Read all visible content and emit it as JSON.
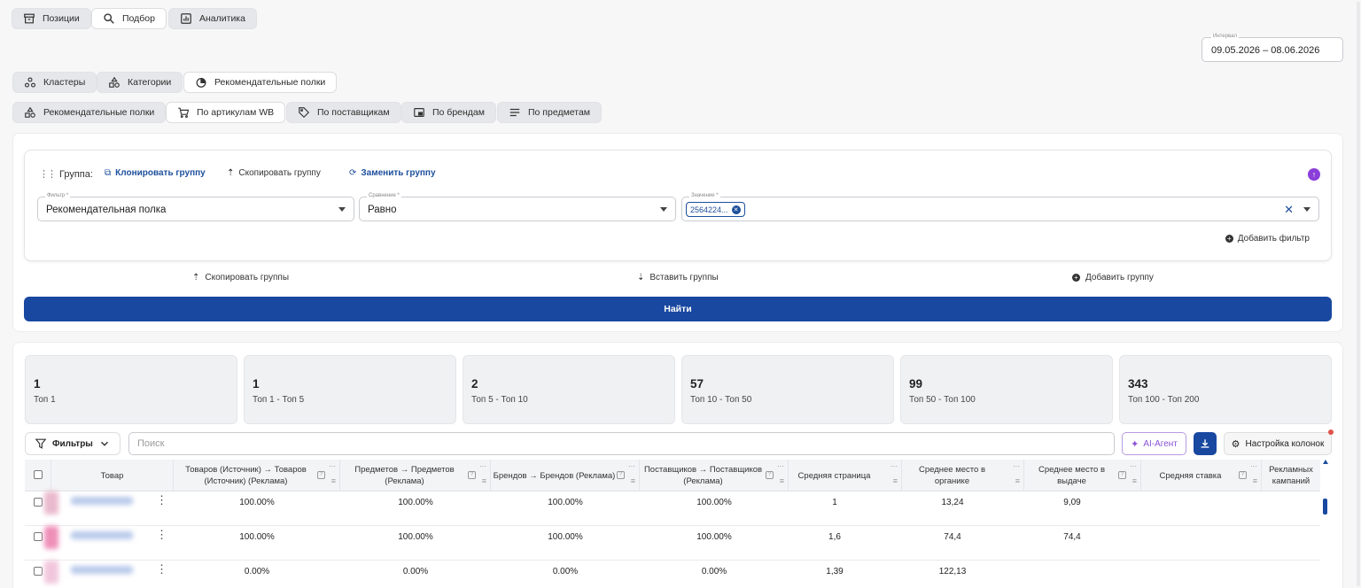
{
  "main_tabs": [
    {
      "label": "Позиции",
      "icon": "archive-box-icon"
    },
    {
      "label": "Подбор",
      "icon": "search-icon"
    },
    {
      "label": "Аналитика",
      "icon": "bar-chart-icon"
    }
  ],
  "date_range": {
    "label": "Интервал",
    "value": "09.05.2026 – 08.06.2026"
  },
  "sub_tabs": [
    {
      "label": "Кластеры",
      "icon": "cluster-icon"
    },
    {
      "label": "Категории",
      "icon": "shapes-icon"
    },
    {
      "label": "Рекомендательные полки",
      "icon": "pie-chart-icon"
    }
  ],
  "filter_tabs": [
    {
      "label": "Рекомендательные полки",
      "icon": "shapes-icon"
    },
    {
      "label": "По артикулам WB",
      "icon": "cart-icon"
    },
    {
      "label": "По поставщикам",
      "icon": "tag-icon"
    },
    {
      "label": "По брендам",
      "icon": "brand-icon"
    },
    {
      "label": "По предметам",
      "icon": "list-icon"
    }
  ],
  "group": {
    "label": "Группа:",
    "clone": "Клонировать группу",
    "copy": "Скопировать группу",
    "replace": "Заменить группу",
    "filter_label": "Фильтр *",
    "filter_value": "Рекомендательная полка",
    "compare_label": "Сравнение *",
    "compare_value": "Равно",
    "value_label": "Значение *",
    "value_chip": "2564224...",
    "add_filter": "Добавить фильтр"
  },
  "actions": {
    "copy_groups": "Скопировать группы",
    "paste_groups": "Вставить группы",
    "add_group": "Добавить группу",
    "find": "Найти"
  },
  "stats": [
    {
      "value": "1",
      "label": "Топ 1"
    },
    {
      "value": "1",
      "label": "Топ 1 - Топ 5"
    },
    {
      "value": "2",
      "label": "Топ 5 - Топ 10"
    },
    {
      "value": "57",
      "label": "Топ 10 - Топ 50"
    },
    {
      "value": "99",
      "label": "Топ 50 - Топ 100"
    },
    {
      "value": "343",
      "label": "Топ 100 - Топ 200"
    }
  ],
  "toolbar": {
    "filters": "Фильтры",
    "search_placeholder": "Поиск",
    "ai": "AI-Агент",
    "columns": "Настройка колонок"
  },
  "table": {
    "headers": [
      "Товар",
      "Товаров (Источник) → Товаров (Источник) (Реклама)",
      "Предметов → Предметов (Реклама)",
      "Брендов → Брендов (Реклама)",
      "Поставщиков → Поставщиков (Реклама)",
      "Средняя страница",
      "Среднее место в органике",
      "Среднее место в выдаче",
      "Средняя ставка",
      "Рекламных кампаний"
    ],
    "rows": [
      {
        "c1": "100.00%",
        "c2": "100.00%",
        "c3": "100.00%",
        "c4": "100.00%",
        "c5": "1",
        "c6": "13,24",
        "c7": "9,09",
        "c8": "",
        "c9": ""
      },
      {
        "c1": "100.00%",
        "c2": "100.00%",
        "c3": "100.00%",
        "c4": "100.00%",
        "c5": "1,6",
        "c6": "74,4",
        "c7": "74,4",
        "c8": "",
        "c9": ""
      },
      {
        "c1": "0.00%",
        "c2": "0.00%",
        "c3": "0.00%",
        "c4": "0.00%",
        "c5": "1,39",
        "c6": "122,13",
        "c7": "",
        "c8": "",
        "c9": ""
      }
    ]
  }
}
